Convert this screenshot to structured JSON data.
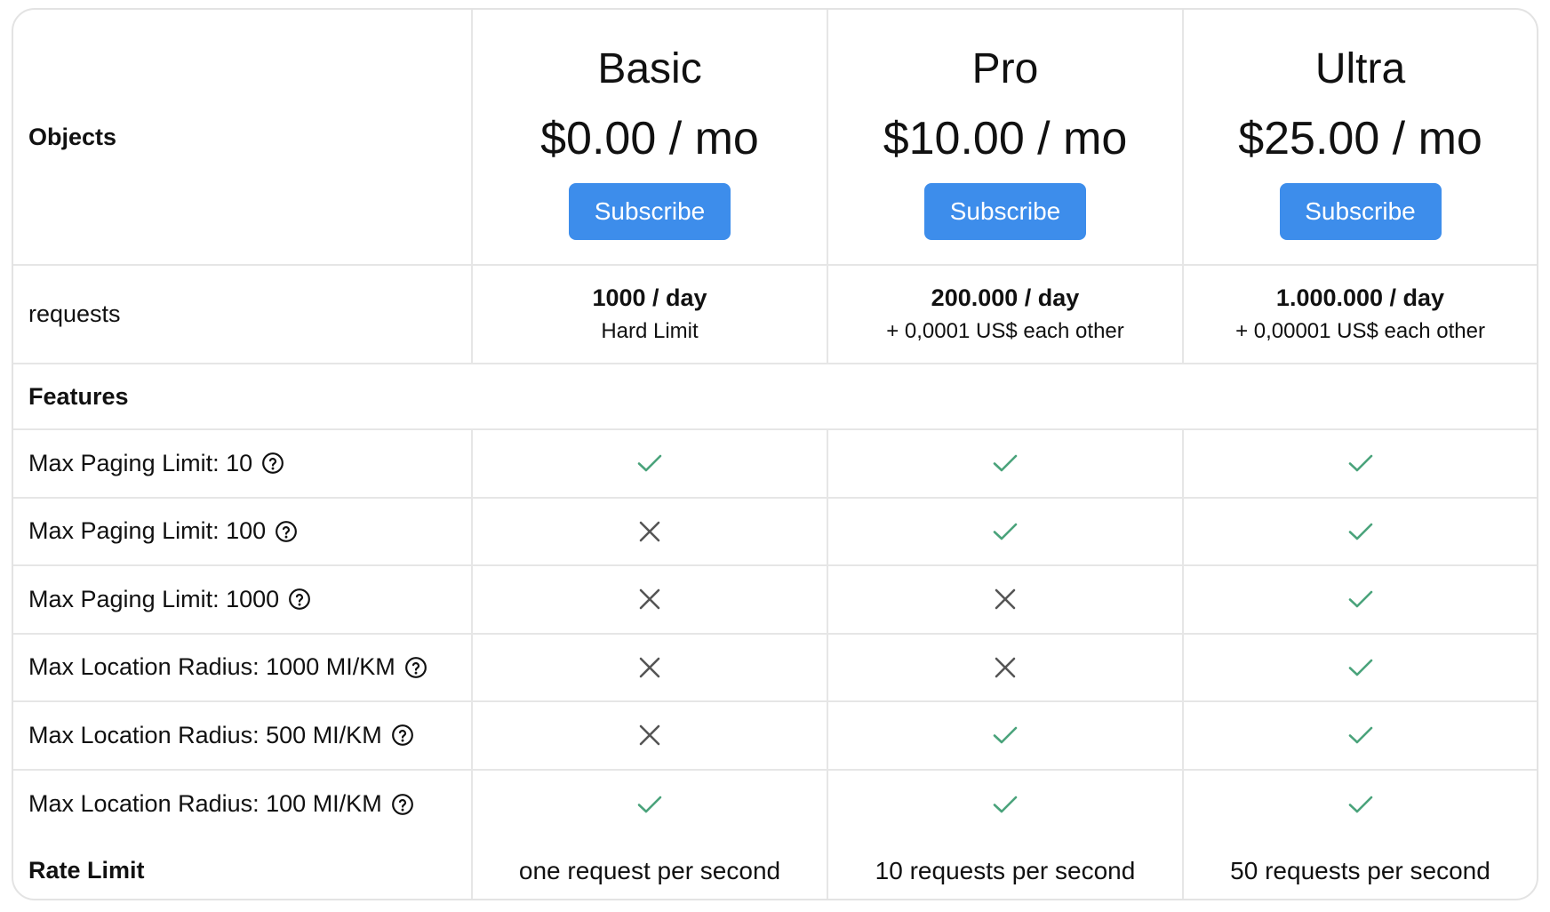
{
  "header": {
    "objects_label": "Objects",
    "plans": [
      {
        "name": "Basic",
        "price": "$0.00 / mo",
        "button_label": "Subscribe"
      },
      {
        "name": "Pro",
        "price": "$10.00 / mo",
        "button_label": "Subscribe"
      },
      {
        "name": "Ultra",
        "price": "$25.00 / mo",
        "button_label": "Subscribe"
      }
    ],
    "button_color": "#3d8deb"
  },
  "requests": {
    "label": "requests",
    "values": [
      {
        "main": "1000 / day",
        "sub": "Hard Limit"
      },
      {
        "main": "200.000 / day",
        "sub": "+ 0,0001 US$ each other"
      },
      {
        "main": "1.000.000 / day",
        "sub": "+ 0,00001 US$ each other"
      }
    ]
  },
  "features": {
    "section_label": "Features",
    "check_color": "#4aa37b",
    "cross_color": "#555555",
    "rows": [
      {
        "label": "Max Paging Limit: 10",
        "icon": "help-icon",
        "included": [
          true,
          true,
          true
        ]
      },
      {
        "label": "Max Paging Limit: 100",
        "icon": "help-icon",
        "included": [
          false,
          true,
          true
        ]
      },
      {
        "label": "Max Paging Limit: 1000",
        "icon": "help-icon",
        "included": [
          false,
          false,
          true
        ]
      },
      {
        "label": "Max Location Radius: 1000 MI/KM",
        "icon": "help-icon",
        "included": [
          false,
          false,
          true
        ]
      },
      {
        "label": "Max Location Radius: 500 MI/KM",
        "icon": "help-icon",
        "included": [
          false,
          true,
          true
        ]
      },
      {
        "label": "Max Location Radius: 100 MI/KM",
        "icon": "help-icon",
        "included": [
          true,
          true,
          true
        ]
      }
    ]
  },
  "rate_limit": {
    "label": "Rate Limit",
    "values": [
      "one request per second",
      "10 requests per second",
      "50 requests per second"
    ]
  }
}
